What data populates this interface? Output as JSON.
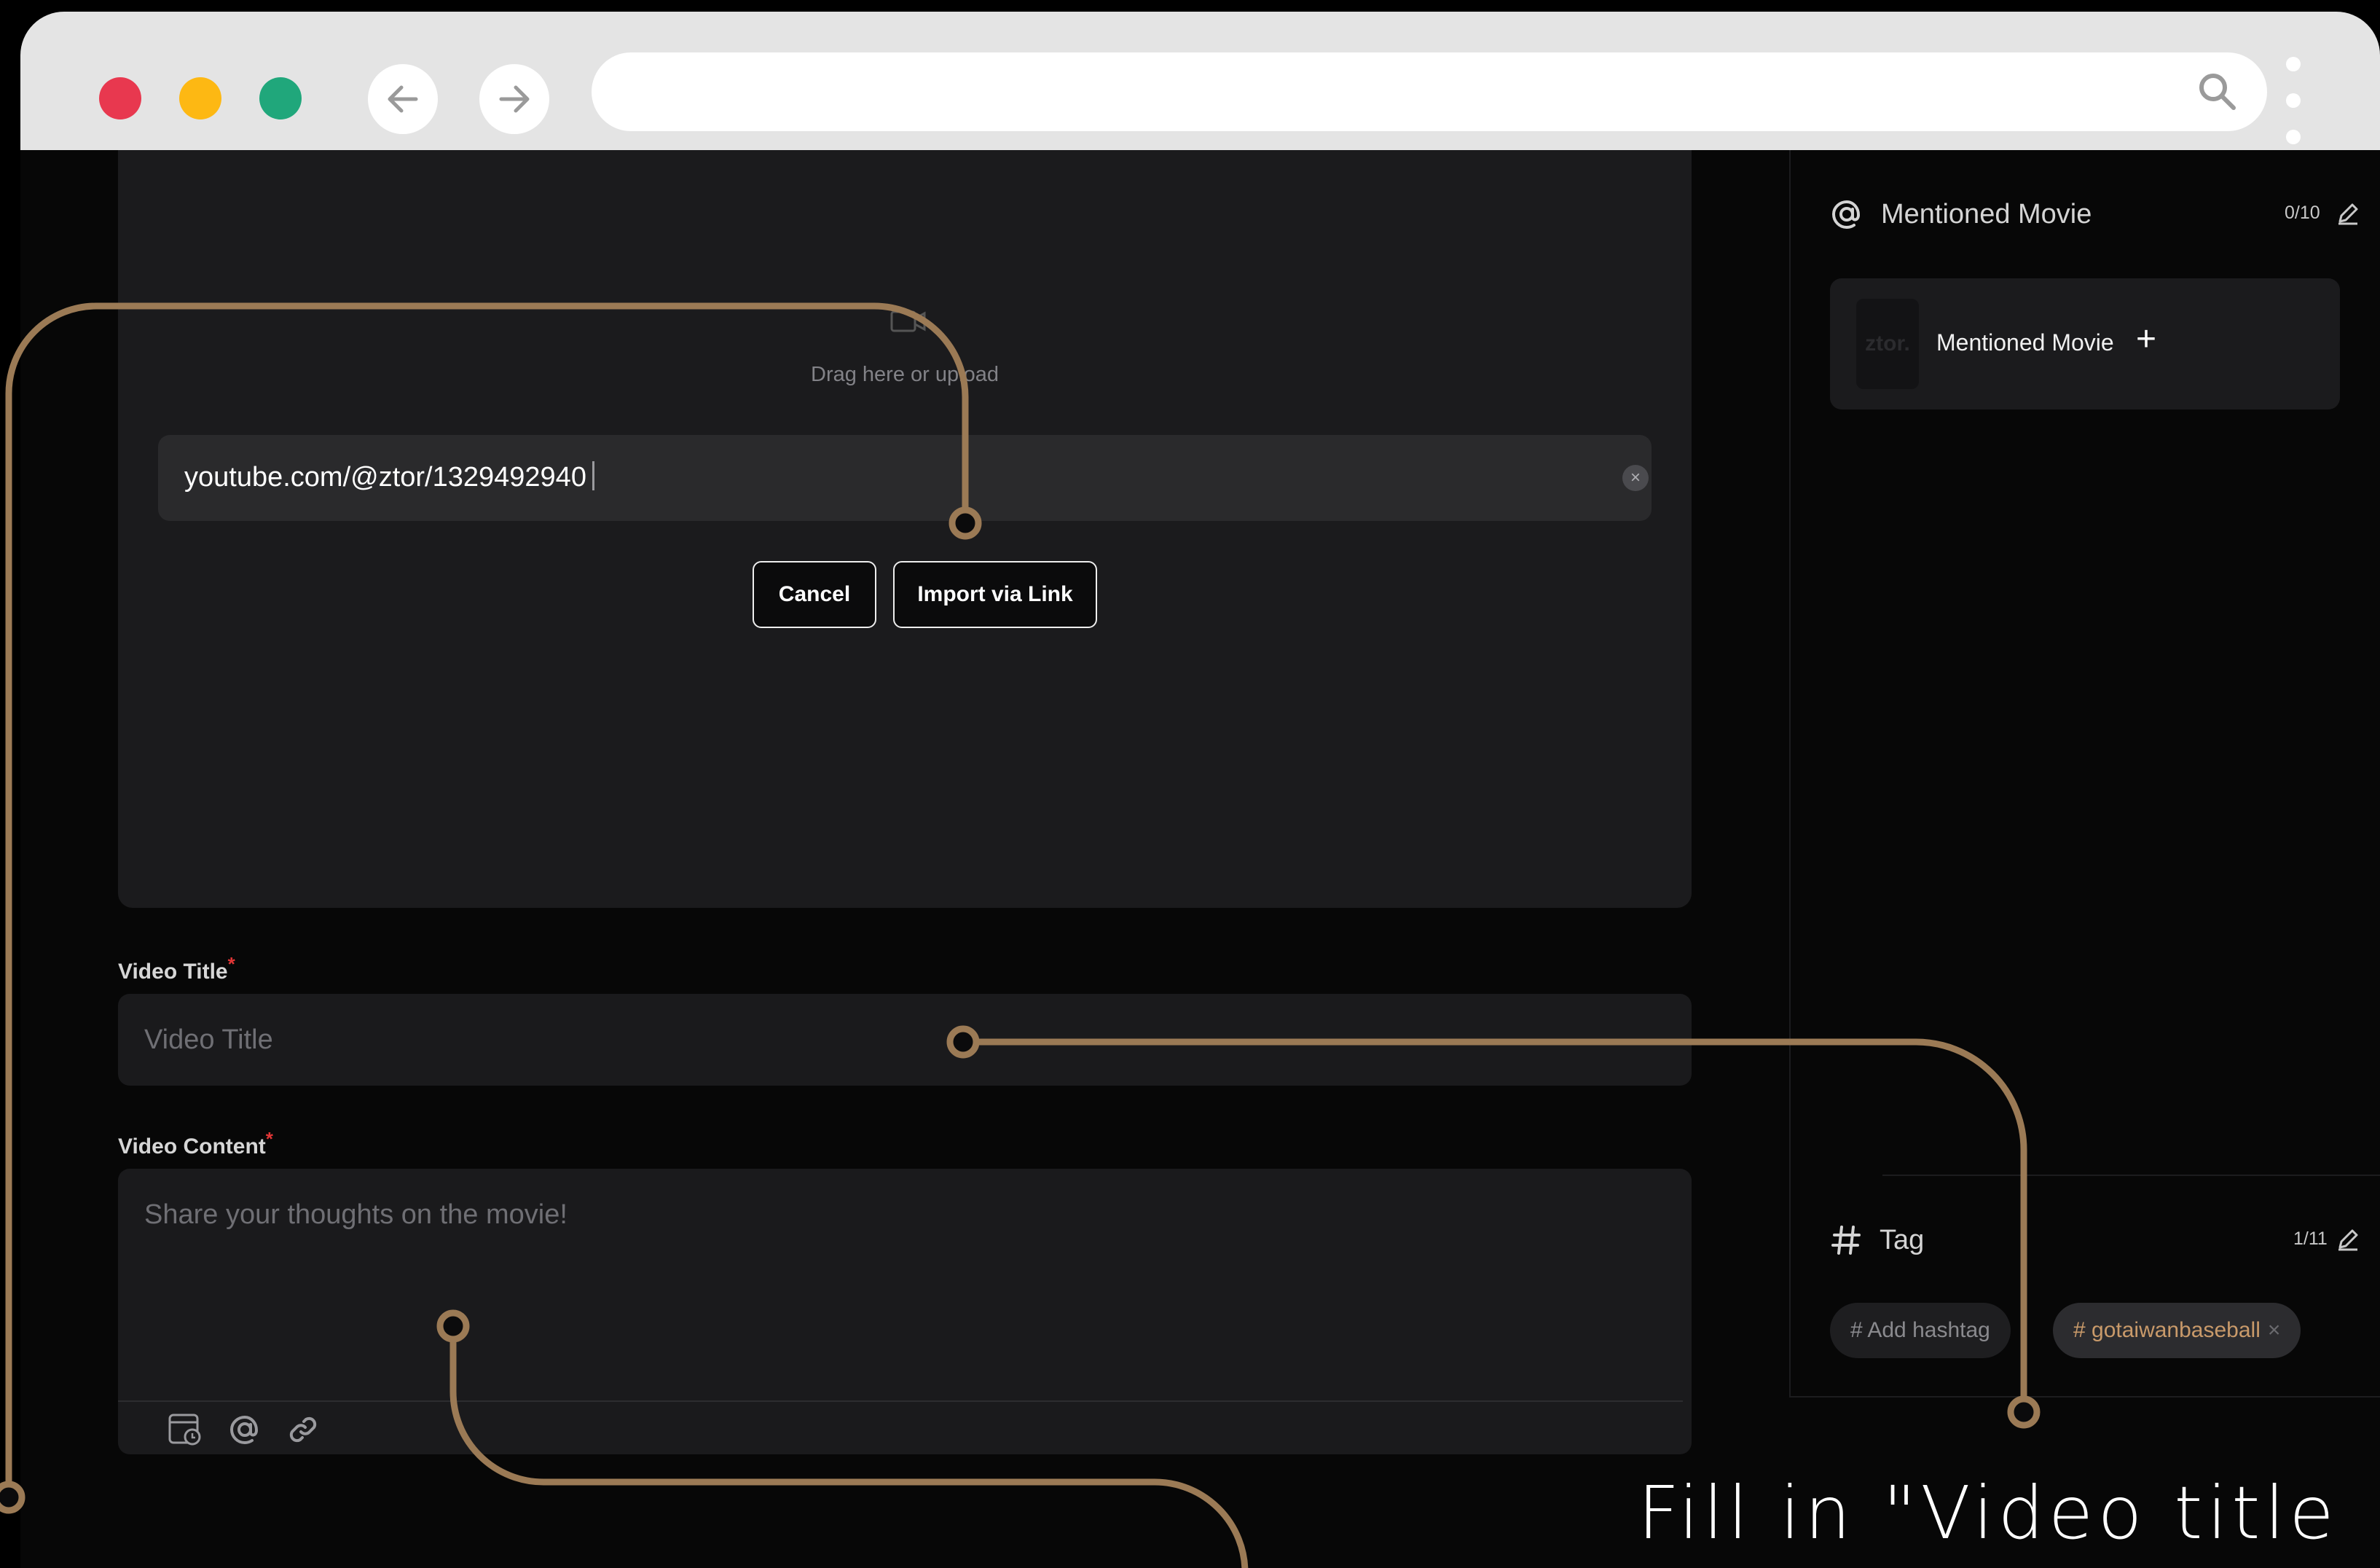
{
  "browser": {
    "window_dots": {
      "close": "#e8384f",
      "minimize": "#fdb813",
      "maximize": "#20a77b"
    },
    "back_icon": "arrow-left-icon",
    "forward_icon": "arrow-right-icon",
    "search_icon": "search-icon",
    "menu_icon": "kebab-menu-icon"
  },
  "upload": {
    "drag_text": "Drag here or upload",
    "link_value": "youtube.com/@ztor/1329492940",
    "cancel_label": "Cancel",
    "import_label": "Import via Link"
  },
  "form": {
    "title_label": "Video Title",
    "title_placeholder": "Video Title",
    "content_label": "Video Content",
    "content_placeholder": "Share your thoughts on the movie!",
    "required_mark": "*",
    "toolbar_icons": [
      "schedule-icon",
      "at-mention-icon",
      "link-icon"
    ]
  },
  "sidebar": {
    "mentioned": {
      "title": "Mentioned Movie",
      "counter": "0/10",
      "card_label": "Mentioned Movie",
      "thumb_text": "ztor.",
      "add_symbol": "+"
    },
    "tag": {
      "title": "Tag",
      "counter": "1/11",
      "add_chip": "# Add hashtag",
      "chips": [
        {
          "label": "# gotaiwanbaseball",
          "remove": "×"
        }
      ]
    }
  },
  "annotation": {
    "caption": "Fill in \"Video title",
    "line_color": "#9b7a55"
  }
}
